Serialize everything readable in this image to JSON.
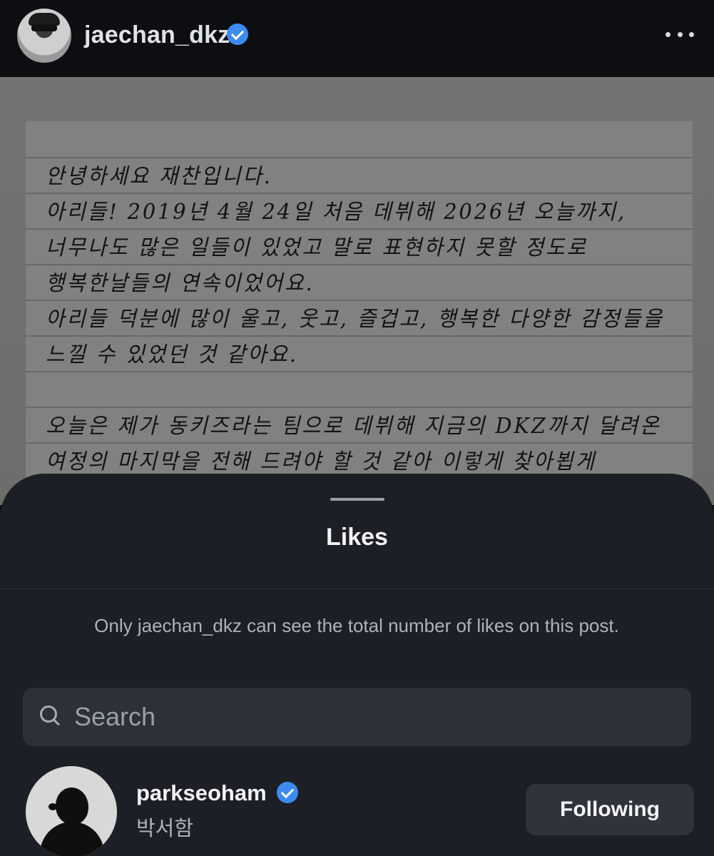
{
  "post_header": {
    "username": "jaechan_dkz",
    "verified_icon": "verified-badge-icon",
    "more_icon": "more-horizontal-icon"
  },
  "post_image": {
    "lines": [
      "안녕하세요 재찬입니다.",
      "아리들! 2019년 4월 24일 처음 데뷔해 2026년 오늘까지,",
      "너무나도 많은 일들이 있었고 말로 표현하지 못할 정도로",
      "행복한날들의 연속이었어요.",
      "아리들 덕분에 많이 울고, 웃고, 즐겁고, 행복한 다양한 감정들을",
      "느낄 수 있었던 것 같아요.",
      "오늘은 제가 동키즈라는 팀으로 데뷔해 지금의 DKZ까지 달려온",
      "여정의 마지막을 전해 드려야 할 것 같아 이렇게 찾아뵙게"
    ]
  },
  "likes_sheet": {
    "title": "Likes",
    "notice": "Only jaechan_dkz can see the total number of likes on this post.",
    "search": {
      "placeholder": "Search",
      "icon": "search-icon"
    },
    "users": [
      {
        "username": "parkseoham",
        "display_name": "박서함",
        "verified": true,
        "button_label": "Following"
      }
    ]
  },
  "colors": {
    "sheet_bg": "#1c1f25",
    "verified_blue": "#3d8bf0",
    "button_bg": "#2f333b"
  }
}
